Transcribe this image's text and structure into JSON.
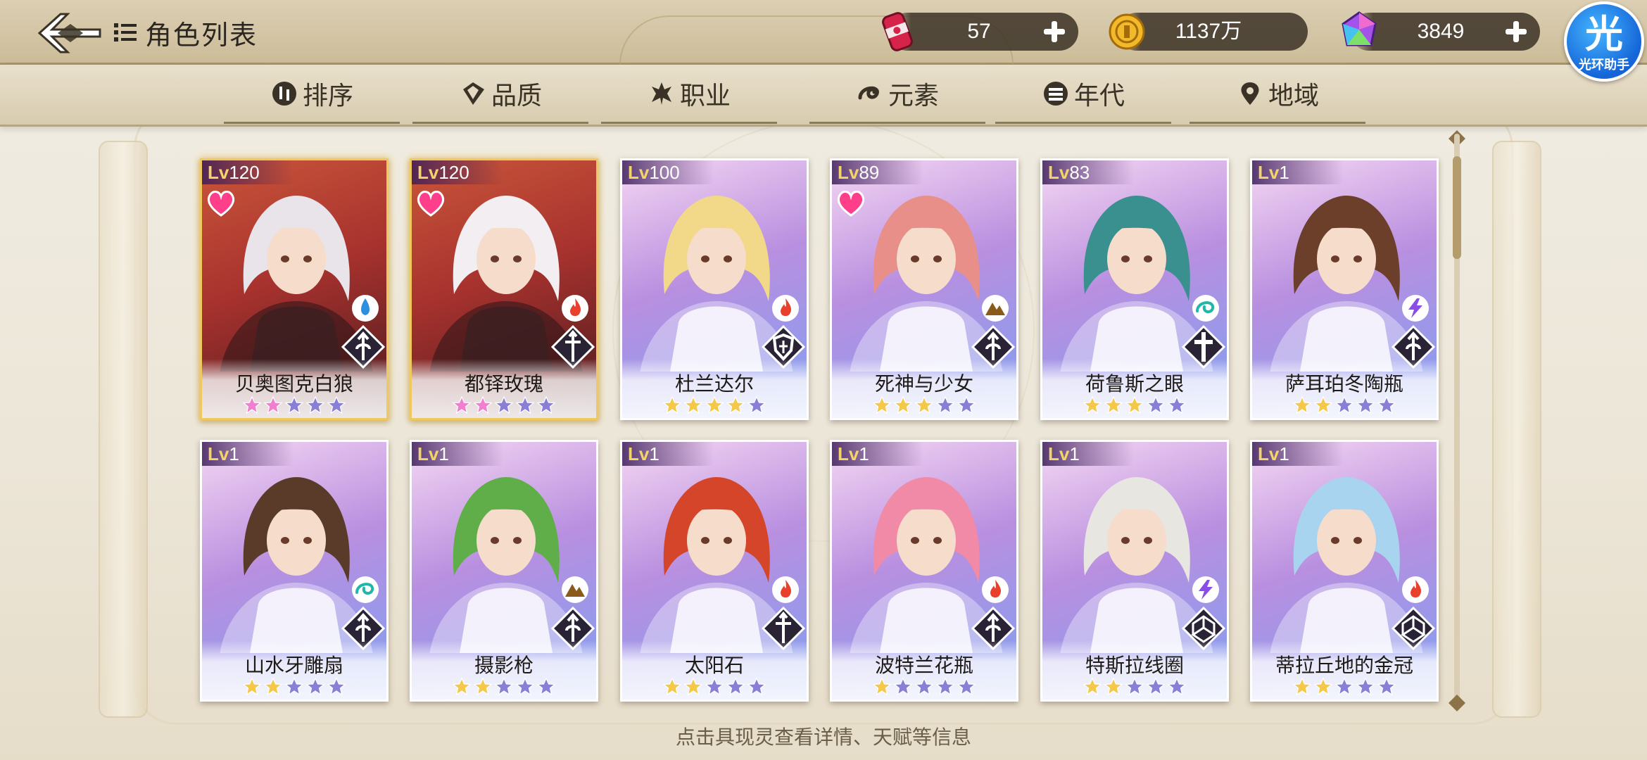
{
  "header": {
    "title": "角色列表",
    "resources": [
      {
        "id": "tickets",
        "icon": "ticket-can-icon",
        "value": "57"
      },
      {
        "id": "gold",
        "icon": "gold-coin-icon",
        "value": "1137万"
      },
      {
        "id": "gems",
        "icon": "rainbow-gem-icon",
        "value": "3849"
      }
    ],
    "helper": {
      "char": "光",
      "label": "光环助手"
    }
  },
  "filters": [
    {
      "label": "排序",
      "icon": "sort-icon"
    },
    {
      "label": "品质",
      "icon": "quality-icon"
    },
    {
      "label": "职业",
      "icon": "class-icon"
    },
    {
      "label": "元素",
      "icon": "element-icon"
    },
    {
      "label": "年代",
      "icon": "era-icon"
    },
    {
      "label": "地域",
      "icon": "region-icon"
    }
  ],
  "lv_prefix": "Lv",
  "colors": {
    "gold_frame": "#f0c860",
    "red_bg": "#a8322e",
    "purple_bg": "#b98fe0",
    "star_filled": "#f4c94a",
    "star_empty": "#8a7fd6",
    "heart": "#ff3f8a"
  },
  "cards": [
    {
      "level": "120",
      "name": "贝奥图克白狼",
      "stars": 2,
      "star_style": "pink",
      "favorite": true,
      "element": "water",
      "class": "spear",
      "frame": "red",
      "hair": "#e8e4ea"
    },
    {
      "level": "120",
      "name": "都铎玫瑰",
      "stars": 2,
      "star_style": "pink",
      "favorite": true,
      "element": "fire",
      "class": "sword",
      "frame": "red",
      "hair": "#f2eef2"
    },
    {
      "level": "100",
      "name": "杜兰达尔",
      "stars": 4,
      "star_style": "gold",
      "favorite": false,
      "element": "fire",
      "class": "shield",
      "frame": "purple",
      "hair": "#f2d98a"
    },
    {
      "level": "89",
      "name": "死神与少女",
      "stars": 3,
      "star_style": "gold",
      "favorite": true,
      "element": "earth",
      "class": "spear",
      "frame": "purple",
      "hair": "#e88f8a"
    },
    {
      "level": "83",
      "name": "荷鲁斯之眼",
      "stars": 3,
      "star_style": "gold",
      "favorite": false,
      "element": "wind",
      "class": "cross",
      "frame": "purple",
      "hair": "#3a8f8f"
    },
    {
      "level": "1",
      "name": "萨耳珀冬陶瓶",
      "stars": 2,
      "star_style": "gold",
      "favorite": false,
      "element": "thunder",
      "class": "spear",
      "frame": "purple",
      "hair": "#6b3f2a"
    },
    {
      "level": "1",
      "name": "山水牙雕扇",
      "stars": 2,
      "star_style": "gold",
      "favorite": false,
      "element": "wind",
      "class": "spear",
      "frame": "purple",
      "hair": "#5a3b2a"
    },
    {
      "level": "1",
      "name": "摄影枪",
      "stars": 2,
      "star_style": "gold",
      "favorite": false,
      "element": "earth",
      "class": "spear",
      "frame": "purple",
      "hair": "#5fae4a"
    },
    {
      "level": "1",
      "name": "太阳石",
      "stars": 2,
      "star_style": "gold",
      "favorite": false,
      "element": "fire",
      "class": "sword",
      "frame": "purple",
      "hair": "#d5452a"
    },
    {
      "level": "1",
      "name": "波特兰花瓶",
      "stars": 1,
      "star_style": "gold",
      "favorite": false,
      "element": "fire",
      "class": "spear",
      "frame": "purple",
      "hair": "#f08aa6"
    },
    {
      "level": "1",
      "name": "特斯拉线圈",
      "stars": 2,
      "star_style": "gold",
      "favorite": false,
      "element": "thunder",
      "class": "book",
      "frame": "purple",
      "hair": "#e8e6e0"
    },
    {
      "level": "1",
      "name": "蒂拉丘地的金冠",
      "stars": 2,
      "star_style": "gold",
      "favorite": false,
      "element": "fire",
      "class": "book",
      "frame": "purple",
      "hair": "#a9d4ef"
    }
  ],
  "footer_hint": "点击具现灵查看详情、天赋等信息"
}
